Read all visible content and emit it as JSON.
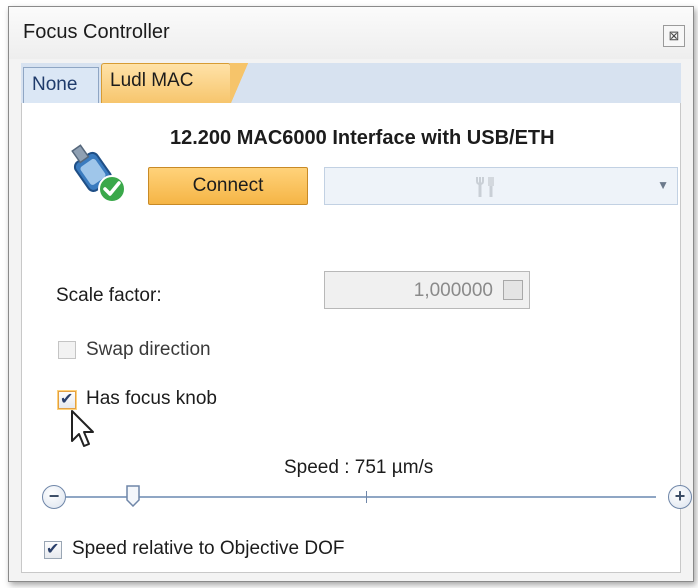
{
  "window": {
    "title": "Focus Controller",
    "close_glyph": "⊠"
  },
  "tabs": [
    {
      "label": "None",
      "active": false
    },
    {
      "label": "Ludl MAC",
      "active": true
    }
  ],
  "device": {
    "name": "12.200 MAC6000 Interface with USB/ETH",
    "icon": "connected-device-icon",
    "connect_label": "Connect",
    "select_icon": "tools-icon"
  },
  "scale": {
    "label": "Scale factor:",
    "value": "1,000000"
  },
  "options": {
    "swap_direction": {
      "label": "Swap direction",
      "checked": false,
      "enabled": false
    },
    "has_focus_knob": {
      "label": "Has focus knob",
      "checked": true,
      "enabled": true
    },
    "speed_relative": {
      "label": "Speed relative to Objective DOF",
      "checked": true,
      "enabled": true
    }
  },
  "speed": {
    "label": "Speed : 751 µm/s",
    "minus": "−",
    "plus": "+"
  },
  "colors": {
    "accent": "#f5b546",
    "tab_blue": "#d7e2f0",
    "check": "#2a3f6a"
  }
}
